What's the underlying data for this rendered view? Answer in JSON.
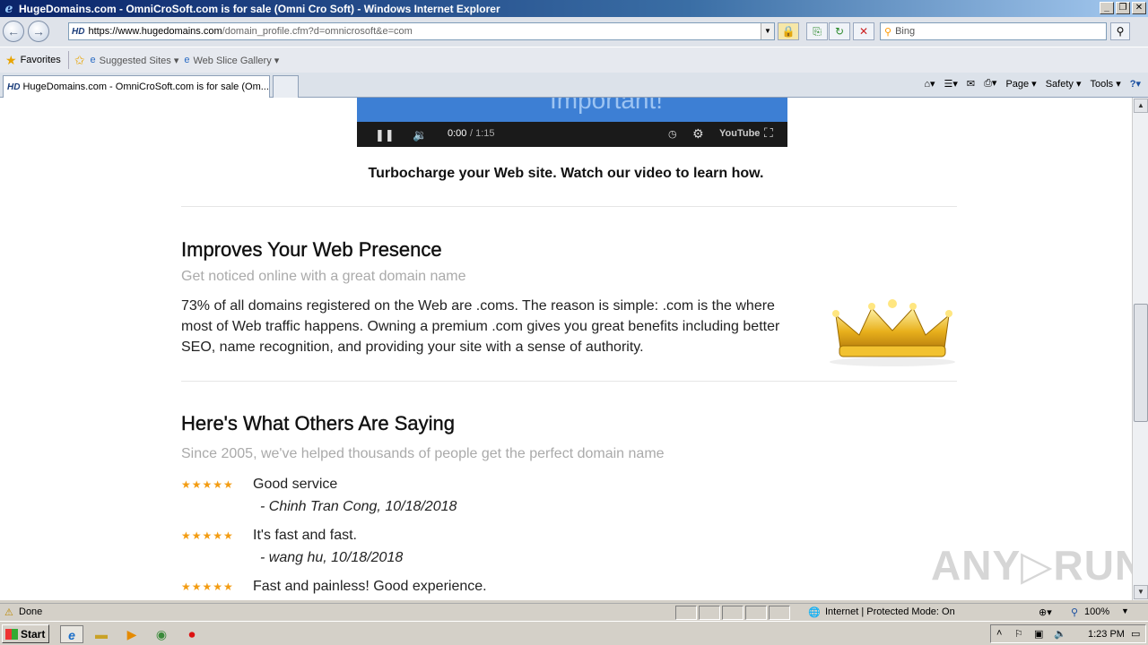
{
  "window": {
    "title": "HugeDomains.com - OmniCroSoft.com is for sale (Omni Cro Soft) - Windows Internet Explorer",
    "minimize": "_",
    "restore": "❐",
    "close": "✕"
  },
  "address_bar": {
    "favicon": "HD",
    "url_main": "https://www.hugedomains.com",
    "url_path": "/domain_profile.cfm?d=omnicrosoft&e=com",
    "dropdown": "▼"
  },
  "toolbar": {
    "back": "←",
    "forward": "→",
    "lock": "🔒",
    "compat": "⎘",
    "refresh": "↻",
    "stop": "✕",
    "search_placeholder": "Bing",
    "search_icon": "⚲"
  },
  "favorites_bar": {
    "favorites_label": "Favorites",
    "suggested_sites": "Suggested Sites ▾",
    "web_slice_gallery": "Web Slice Gallery ▾"
  },
  "tab": {
    "favicon": "HD",
    "label": "HugeDomains.com - OmniCroSoft.com is for sale (Om..."
  },
  "command_bar": {
    "page": "Page ▾",
    "safety": "Safety ▾",
    "tools": "Tools ▾",
    "help": "?▾",
    "home": "⌂▾",
    "feeds": "☰▾",
    "mail": "✉",
    "print": "⎙▾"
  },
  "video": {
    "overlay_text": "Important!",
    "time_current": "0:00",
    "time_total": "/ 1:15",
    "brand": "YouTube"
  },
  "page": {
    "video_caption": "Turbocharge your Web site. Watch our video to learn how.",
    "presence": {
      "heading": "Improves Your Web Presence",
      "subheading": "Get noticed online with a great domain name",
      "body": "73% of all domains registered on the Web are .coms. The reason is simple: .com is the where most of Web traffic happens. Owning a premium .com gives you great benefits including better SEO, name recognition, and providing your site with a sense of authority."
    },
    "testimonials": {
      "heading": "Here's What Others Are Saying",
      "subheading": "Since 2005, we've helped thousands of people get the perfect domain name",
      "reviews": [
        {
          "stars": "★★★★★",
          "rating": 5,
          "text": "Good service",
          "author": "- Chinh Tran Cong, 10/18/2018"
        },
        {
          "stars": "★★★★★",
          "rating": 5,
          "text": "It's fast and fast.",
          "author": "- wang hu, 10/18/2018"
        },
        {
          "stars": "★★★★★",
          "rating": 5,
          "text": "Fast and painless! Good experience.",
          "author": ""
        }
      ]
    },
    "watermark": "ANY▷RUN"
  },
  "status_bar": {
    "status": "Done",
    "zone": "Internet | Protected Mode: On",
    "zoom": "100%"
  },
  "taskbar": {
    "start": "Start",
    "clock": "1:23 PM"
  },
  "colors": {
    "titlebar": "#0a246a",
    "accent_star": "#f39c12",
    "video_blue": "#3d7fd4"
  }
}
